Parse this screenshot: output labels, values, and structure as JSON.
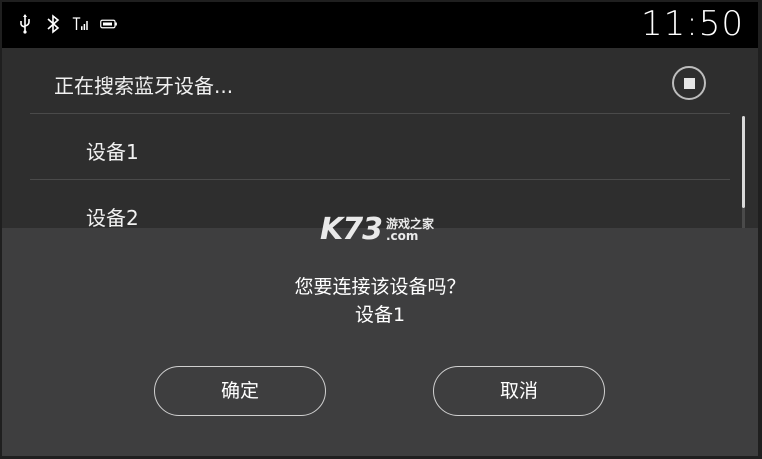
{
  "status_bar": {
    "icons": [
      "usb-icon",
      "bluetooth-icon",
      "signal-icon",
      "battery-icon"
    ],
    "time": "11:50"
  },
  "device_list": {
    "searching_label": "正在搜索蓝牙设备...",
    "devices": [
      {
        "name": "设备1"
      },
      {
        "name": "设备2"
      }
    ]
  },
  "dialog": {
    "question": "您要连接该设备吗？",
    "device_name": "设备1",
    "confirm_label": "确定",
    "cancel_label": "取消"
  },
  "watermark": {
    "logo": "K73",
    "line1": "游戏之家",
    "line2": ".com"
  }
}
